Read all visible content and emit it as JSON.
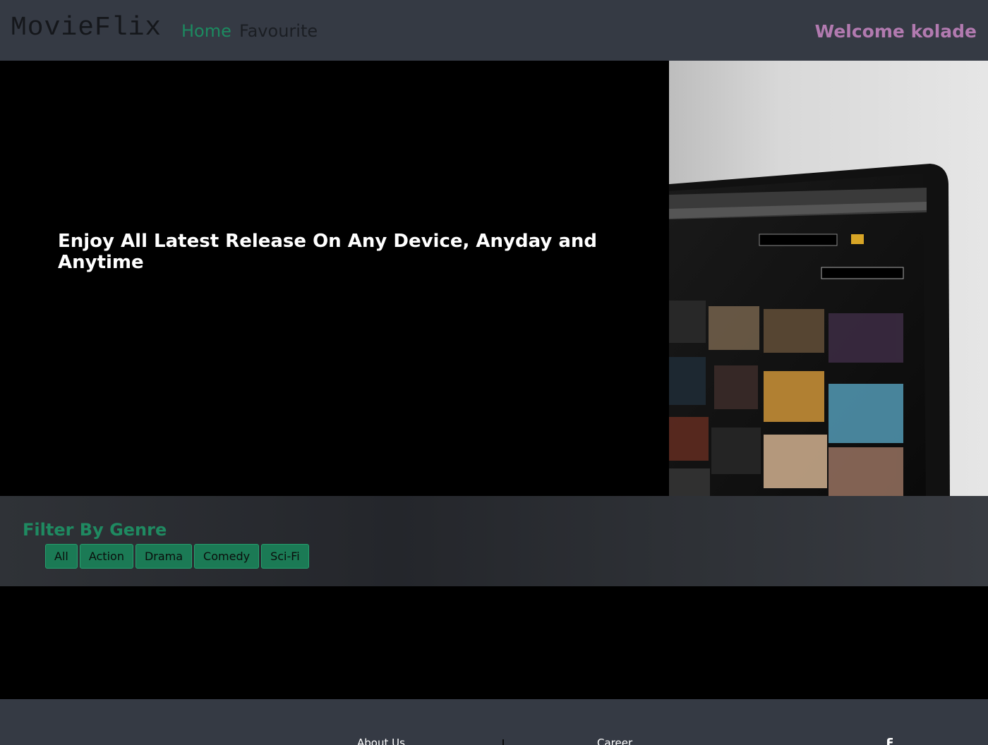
{
  "navbar": {
    "brand": "MovieFlix",
    "links": [
      {
        "label": "Home",
        "active": true
      },
      {
        "label": "Favourite",
        "active": false
      }
    ],
    "welcome": "Welcome kolade"
  },
  "hero": {
    "headline": "Enjoy All Latest Release On Any Device, Anyday and Anytime",
    "image_icon": "laptop-streaming-image"
  },
  "filter": {
    "title": "Filter By Genre",
    "genres": [
      "All",
      "Action",
      "Drama",
      "Comedy",
      "Sci-Fi"
    ]
  },
  "footer": {
    "links": [
      "About Us",
      "Career"
    ],
    "social_icon": "facebook-icon"
  },
  "colors": {
    "header_bg": "#353a44",
    "accent_green": "#1b7a55",
    "welcome_pink": "#b27ab0"
  }
}
